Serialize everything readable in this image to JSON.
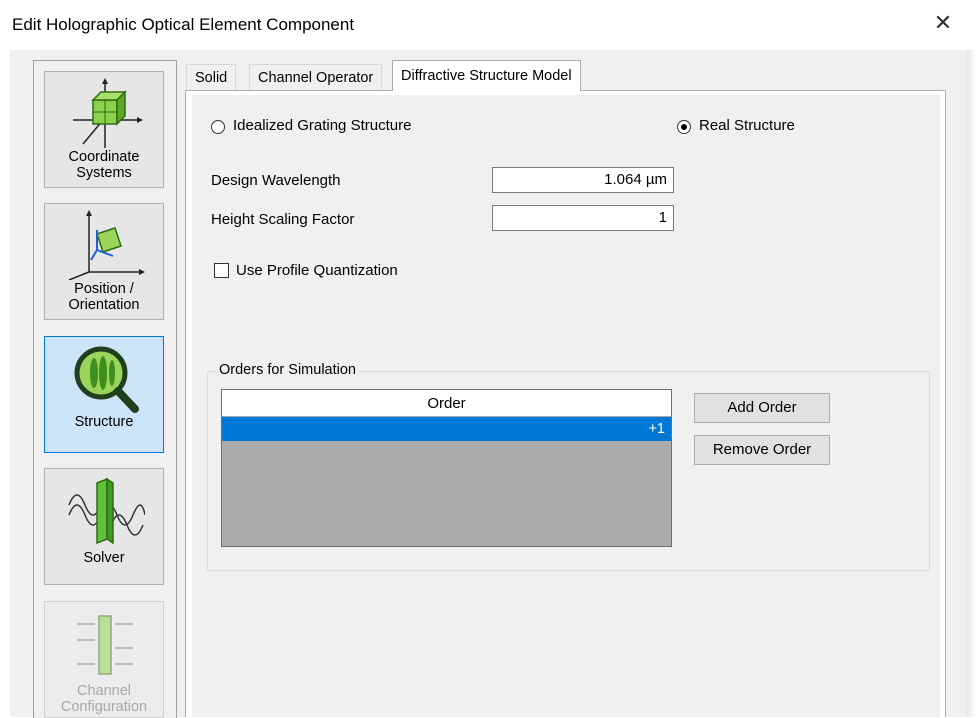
{
  "window": {
    "title": "Edit Holographic Optical Element Component",
    "close_label": "✕"
  },
  "nav": [
    {
      "label": "Coordinate Systems",
      "state": "normal"
    },
    {
      "label": "Position / Orientation",
      "state": "normal"
    },
    {
      "label": "Structure",
      "state": "active"
    },
    {
      "label": "Solver",
      "state": "normal"
    },
    {
      "label": "Channel Configuration",
      "state": "disabled"
    }
  ],
  "tabs": [
    {
      "label": "Solid"
    },
    {
      "label": "Channel Operator"
    },
    {
      "label": "Diffractive Structure Model",
      "selected": true
    }
  ],
  "model": {
    "idealized_label": "Idealized Grating Structure",
    "real_label": "Real Structure",
    "selected": "Real Structure",
    "wavelength_label": "Design Wavelength",
    "wavelength_value": "1.064 µm",
    "scaling_label": "Height Scaling Factor",
    "scaling_value": "1",
    "quantization_label": "Use Profile Quantization",
    "quantization_checked": false
  },
  "orders": {
    "group_title": "Orders for Simulation",
    "column_header": "Order",
    "rows": [
      "+1"
    ],
    "add_label": "Add Order",
    "remove_label": "Remove Order"
  },
  "colors": {
    "accent": "#0078d7",
    "grid_empty": "#ababab",
    "dialog_bg": "#f0f0f0"
  }
}
